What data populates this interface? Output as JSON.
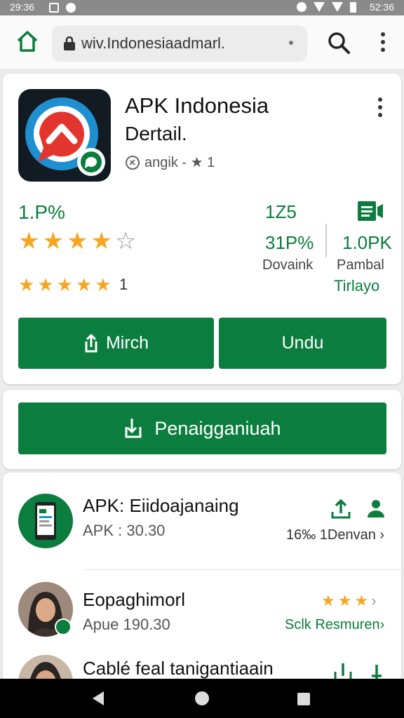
{
  "status_bar": {
    "time_left": "29:36",
    "time_right": "52:36"
  },
  "url_bar": {
    "url": "wiv.Indonesiaadmarl."
  },
  "app": {
    "title": "APK Indonesia",
    "subtitle": "Dertail.",
    "meta": "angik - ★ 1",
    "rating_pct": "1.P%",
    "stars_small_count": "1",
    "stat1": {
      "top": "1Z5",
      "value": "31P%",
      "label": "Dovaink"
    },
    "stat2": {
      "value": "1.0PK",
      "label": "Pambal",
      "link": "Tirlayo"
    }
  },
  "buttons": {
    "mirror_label": "Mirch",
    "unduh_label": "Undu",
    "main_label": "Penaigganiuah"
  },
  "list": [
    {
      "title": "APK: Eiidoajanaing",
      "sub": "APK : 30.30",
      "right": "16‰ 1Denvan ›"
    },
    {
      "title": "Eopaghimorl",
      "sub": "Apue 190.30",
      "right": "Sclk Resmuren›"
    },
    {
      "title": "Cablé feal tanigantiaain"
    }
  ],
  "colors": {
    "accent_green": "#0b7d3e",
    "star": "#f5a623",
    "status_bar": "#8a8a8a"
  }
}
